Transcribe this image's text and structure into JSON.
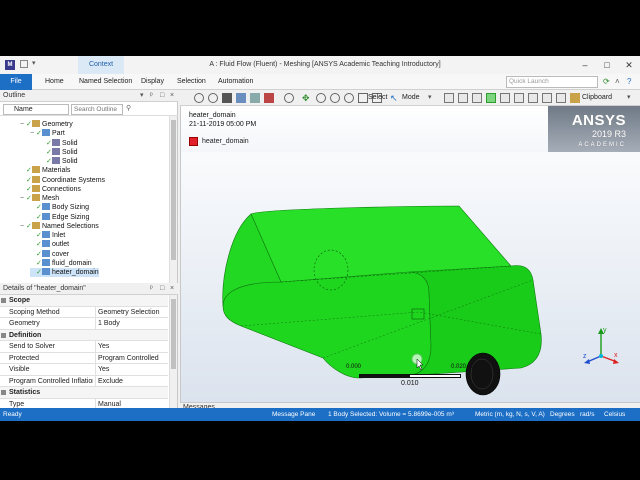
{
  "titlebar": {
    "context_tab": "Context",
    "title": "A : Fluid Flow (Fluent) - Meshing [ANSYS Academic Teaching Introductory]",
    "minimize": "–",
    "maximize": "□",
    "close": "✕"
  },
  "ribbon": {
    "file": "File",
    "tabs": [
      "Home",
      "Named Selection",
      "Display",
      "Selection",
      "Automation"
    ],
    "quick_launch_placeholder": "Quick Launch"
  },
  "outline": {
    "header": "Outline",
    "filter_select": "Name",
    "search_placeholder": "Search Outline",
    "tree": [
      {
        "label": "Geometry",
        "level": 1
      },
      {
        "label": "Part",
        "level": 2
      },
      {
        "label": "Solid",
        "level": 3
      },
      {
        "label": "Solid",
        "level": 3
      },
      {
        "label": "Solid",
        "level": 3
      },
      {
        "label": "Materials",
        "level": 1
      },
      {
        "label": "Coordinate Systems",
        "level": 1
      },
      {
        "label": "Connections",
        "level": 1
      },
      {
        "label": "Mesh",
        "level": 1
      },
      {
        "label": "Body Sizing",
        "level": 2
      },
      {
        "label": "Edge Sizing",
        "level": 2
      },
      {
        "label": "Named Selections",
        "level": 1
      },
      {
        "label": "Inlet",
        "level": 2
      },
      {
        "label": "outlet",
        "level": 2
      },
      {
        "label": "cover",
        "level": 2
      },
      {
        "label": "fluid_domain",
        "level": 2
      },
      {
        "label": "heater_domain",
        "level": 2
      }
    ]
  },
  "details": {
    "header": "Details of \"heater_domain\"",
    "rows": [
      {
        "section": "Scope"
      },
      {
        "key": "Scoping Method",
        "value": "Geometry Selection"
      },
      {
        "key": "Geometry",
        "value": "1 Body"
      },
      {
        "section": "Definition"
      },
      {
        "key": "Send to Solver",
        "value": "Yes"
      },
      {
        "key": "Protected",
        "value": "Program Controlled"
      },
      {
        "key": "Visible",
        "value": "Yes"
      },
      {
        "key": "Program Controlled Inflation",
        "value": "Exclude"
      },
      {
        "section": "Statistics"
      },
      {
        "key": "Type",
        "value": "Manual"
      }
    ]
  },
  "graphics_toolbar": {
    "select_label": "Select",
    "mode_label": "Mode",
    "clipboard_label": "Clipboard"
  },
  "viewport": {
    "object_name": "heater_domain",
    "timestamp": "21-11-2019 05:00 PM",
    "legend_label": "heater_domain",
    "legend_color": "#e0202a",
    "body_color": "#1fd61f",
    "brand_name": "ANSYS",
    "brand_version": "2019 R3",
    "brand_edition": "ACADEMIC",
    "scale_left": "0.000",
    "scale_right": "0.020 (m)",
    "scale_mid": "0.010"
  },
  "messages": {
    "label": "Messages"
  },
  "statusbar": {
    "ready": "Ready",
    "message_pane": "Message Pane",
    "selection": "1 Body Selected: Volume = 5.8699e-005 m³",
    "units": "Metric (m, kg, N, s, V, A)",
    "angle": "Degrees",
    "rate": "rad/s",
    "temperature": "Celsius"
  }
}
